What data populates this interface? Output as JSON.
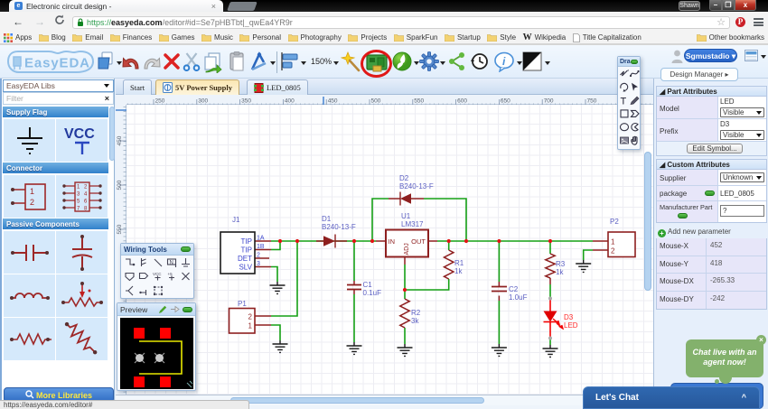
{
  "browser": {
    "tab_title": "Electronic circuit design -",
    "tab_close": "×",
    "url": {
      "scheme": "https://",
      "host": "easyeda.com",
      "path": "/editor#id=Se7pHBTbt|_qwEa4YR9r"
    },
    "user_chip": "Shawn",
    "win_min": "–",
    "win_max": "❐",
    "win_close": "x",
    "back": "←",
    "forward": "→",
    "bookmarks": {
      "apps": "Apps",
      "items": [
        "Blog",
        "Email",
        "Finances",
        "Games",
        "Music",
        "Personal",
        "Photography",
        "Projects",
        "SparkFun",
        "Startup",
        "Style",
        "Wikipedia",
        "Title Capitalization"
      ],
      "other": "Other bookmarks"
    }
  },
  "toolbar": {
    "zoom": "150%",
    "user_button": "Sgmustadio ▾"
  },
  "tabs": {
    "start": "Start",
    "active": "5V Power Supply",
    "third": "LED_0805"
  },
  "ruler": {
    "h_labels": [
      "250",
      "300",
      "350",
      "400",
      "450",
      "500",
      "550",
      "600",
      "650",
      "700",
      "750"
    ],
    "v_labels": [
      "450",
      "500",
      "550"
    ]
  },
  "sidebar": {
    "libs_select": "EasyEDA Libs",
    "filter_placeholder": "Filter",
    "clear": "×",
    "sections": [
      {
        "title": "Supply Flag",
        "items": [
          "gnd",
          "vcc"
        ]
      },
      {
        "title": "Connector",
        "items": [
          "conn2",
          "conn8"
        ]
      },
      {
        "title": "Passive Components",
        "items": [
          "cap-h",
          "cap-v",
          "inductor",
          "potentiometer",
          "resistor-h",
          "resistor-diag"
        ]
      }
    ],
    "more_libraries": "More Libraries"
  },
  "palettes": {
    "wiring": "Wiring Tools",
    "preview": "Preview",
    "drawing": "Dra..."
  },
  "schematic": {
    "j1": {
      "ref": "J1",
      "pin_names": [
        "TIP",
        "TIP",
        "DET",
        "SLV"
      ],
      "pin_nums": [
        "1A",
        "1B",
        "2",
        "3"
      ]
    },
    "p1": {
      "ref": "P1",
      "pin_nums": [
        "2",
        "1"
      ]
    },
    "p2": {
      "ref": "P2",
      "pin_nums": [
        "1",
        "2"
      ]
    },
    "d1": {
      "ref": "D1",
      "value": "B240-13-F"
    },
    "d2": {
      "ref": "D2",
      "value": "B240-13-F"
    },
    "d3": {
      "ref": "D3",
      "value": "LED"
    },
    "u1": {
      "ref": "U1",
      "value": "LM317",
      "pin_in": "IN",
      "pin_out": "OUT",
      "pin_adj": "ADJ"
    },
    "c1": {
      "ref": "C1",
      "value": "0.1uF"
    },
    "c2": {
      "ref": "C2",
      "value": "1.0uF"
    },
    "r1": {
      "ref": "R1",
      "value": "1k"
    },
    "r2": {
      "ref": "R2",
      "value": "3k"
    },
    "r3": {
      "ref": "R3",
      "value": "1k"
    }
  },
  "panel": {
    "design_manager": "Design Manager ▸",
    "part_attributes": {
      "title": "Part Attributes",
      "rows": [
        {
          "label": "Model",
          "value": "LED",
          "visibility": "Visible"
        },
        {
          "label": "Prefix",
          "value": "D3",
          "visibility": "Visible"
        }
      ],
      "edit_symbol": "Edit Symbol..."
    },
    "custom_attributes": {
      "title": "Custom Attributes",
      "supplier_label": "Supplier",
      "supplier_value": "Unknown",
      "package_label": "package",
      "package_value": "LED_0805",
      "manufacturer_label": "Manufacturer Part",
      "manufacturer_value": "?",
      "add_new": "Add new parameter"
    },
    "mouse": [
      {
        "label": "Mouse-X",
        "value": "452"
      },
      {
        "label": "Mouse-Y",
        "value": "418"
      },
      {
        "label": "Mouse-DX",
        "value": "-265.33"
      },
      {
        "label": "Mouse-DY",
        "value": "-242"
      }
    ]
  },
  "chat": {
    "line1": "Chat live with an",
    "line2": "agent now!",
    "close": "×",
    "bar": "Let's Chat",
    "chevron": "^"
  },
  "status_text": "https://easyeda.com/editor#"
}
